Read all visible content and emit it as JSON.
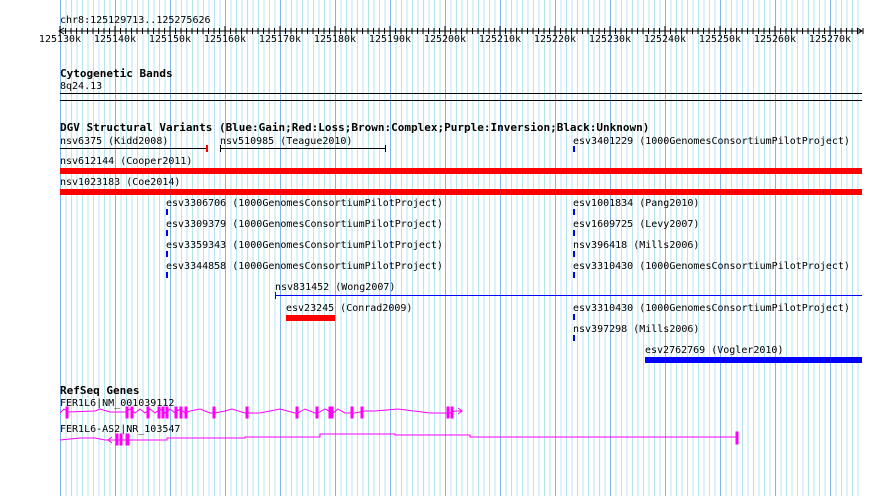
{
  "ruler": {
    "location": "chr8:125129713..125275626",
    "ticks": [
      "125130k",
      "125140k",
      "125150k",
      "125160k",
      "125170k",
      "125180k",
      "125190k",
      "125200k",
      "125210k",
      "125220k",
      "125230k",
      "125240k",
      "125250k",
      "125260k",
      "125270k"
    ]
  },
  "cyto": {
    "title": "Cytogenetic Bands",
    "band": "8q24.13"
  },
  "dgv": {
    "title": "DGV Structural Variants (Blue:Gain;Red:Loss;Brown:Complex;Purple:Inversion;Black:Unknown)",
    "features": [
      "nsv6375 (Kidd2008)",
      "nsv510985 (Teague2010)",
      "esv3401229 (1000GenomesConsortiumPilotProject)",
      "nsv612144 (Cooper2011)",
      "nsv1023183 (Coe2014)",
      "esv3306706 (1000GenomesConsortiumPilotProject)",
      "esv3309379 (1000GenomesConsortiumPilotProject)",
      "esv3359343 (1000GenomesConsortiumPilotProject)",
      "esv3344858 (1000GenomesConsortiumPilotProject)",
      "esv1001834 (Pang2010)",
      "esv1609725 (Levy2007)",
      "nsv396418 (Mills2006)",
      "esv3310430 (1000GenomesConsortiumPilotProject)",
      "nsv831452 (Wong2007)",
      "esv23245 (Conrad2009)",
      "esv3310430 (1000GenomesConsortiumPilotProject)",
      "nsv397298 (Mills2006)",
      "esv2762769 (Vogler2010)"
    ]
  },
  "refseq": {
    "title": "RefSeq Genes",
    "genes": [
      "FER1L6|NM_001039112",
      "FER1L6-AS2|NR_103547"
    ]
  },
  "colors": {
    "gain": "#0000ff",
    "loss": "#ff0000",
    "gene": "#ff00ff"
  }
}
